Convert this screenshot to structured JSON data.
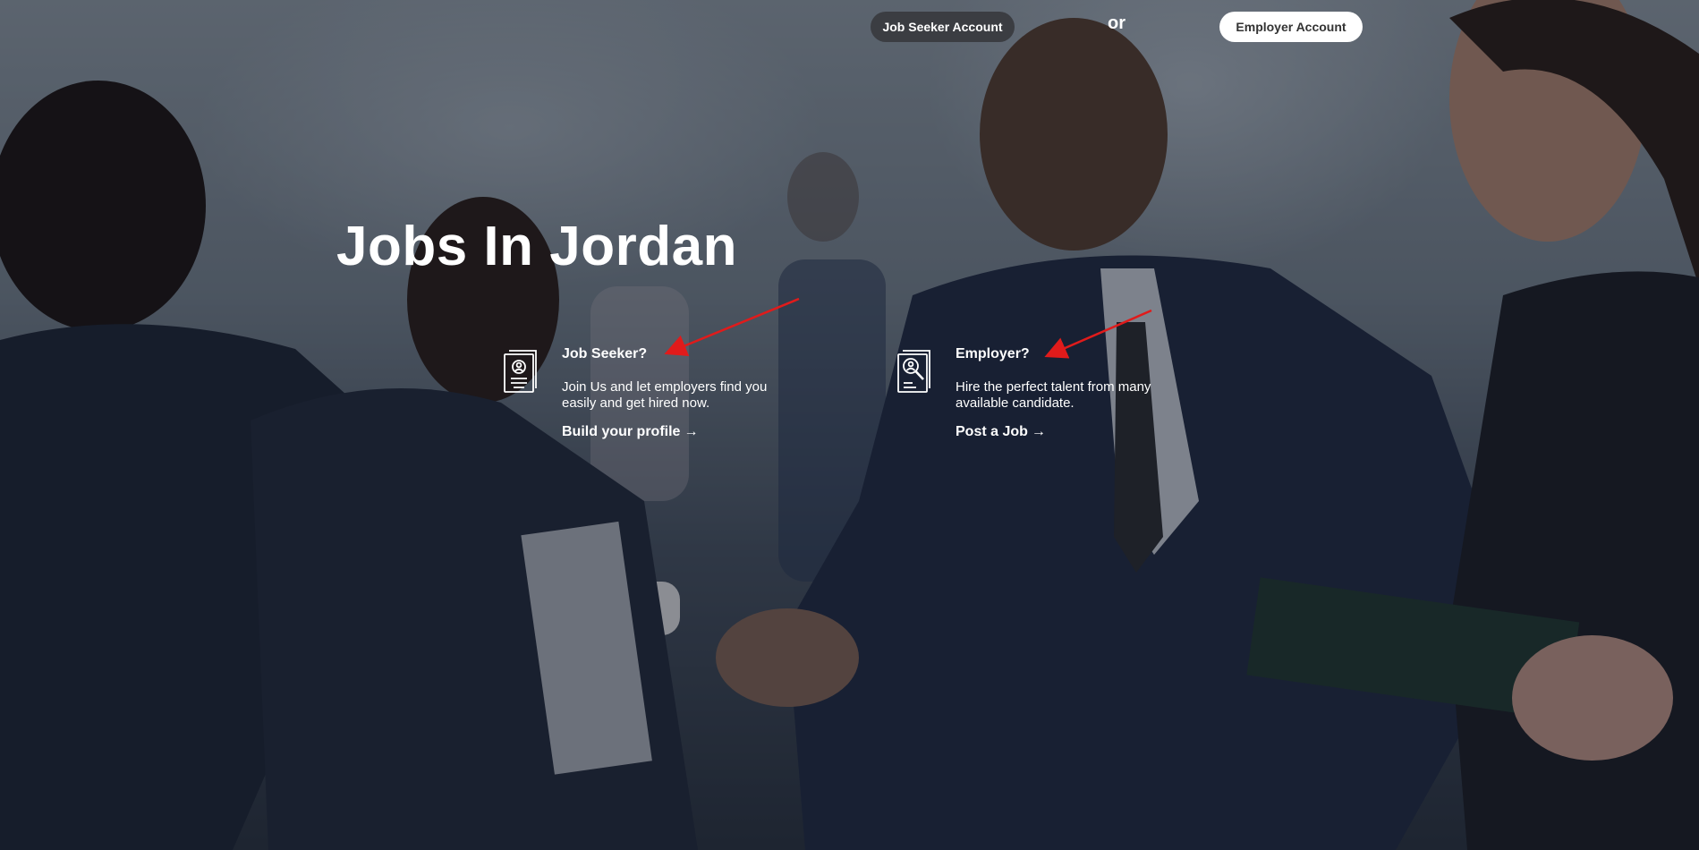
{
  "header": {
    "job_seeker_button": "Job Seeker Account",
    "or_text": "or",
    "employer_button": "Employer Account"
  },
  "hero": {
    "title": "Jobs In Jordan"
  },
  "cards": [
    {
      "heading": "Job Seeker?",
      "description": "Join Us and let employers find you easily and get hired now.",
      "link": "Build your profile",
      "icon": "resume-document-icon"
    },
    {
      "heading": "Employer?",
      "description": "Hire the perfect talent from many available candidate.",
      "link": "Post a Job",
      "icon": "candidate-search-icon"
    }
  ],
  "colors": {
    "overlay": "#0f141e",
    "seeker_button_bg": "#3b3d42",
    "employer_button_bg": "#ffffff",
    "annotation_arrow": "#e01b1b"
  }
}
